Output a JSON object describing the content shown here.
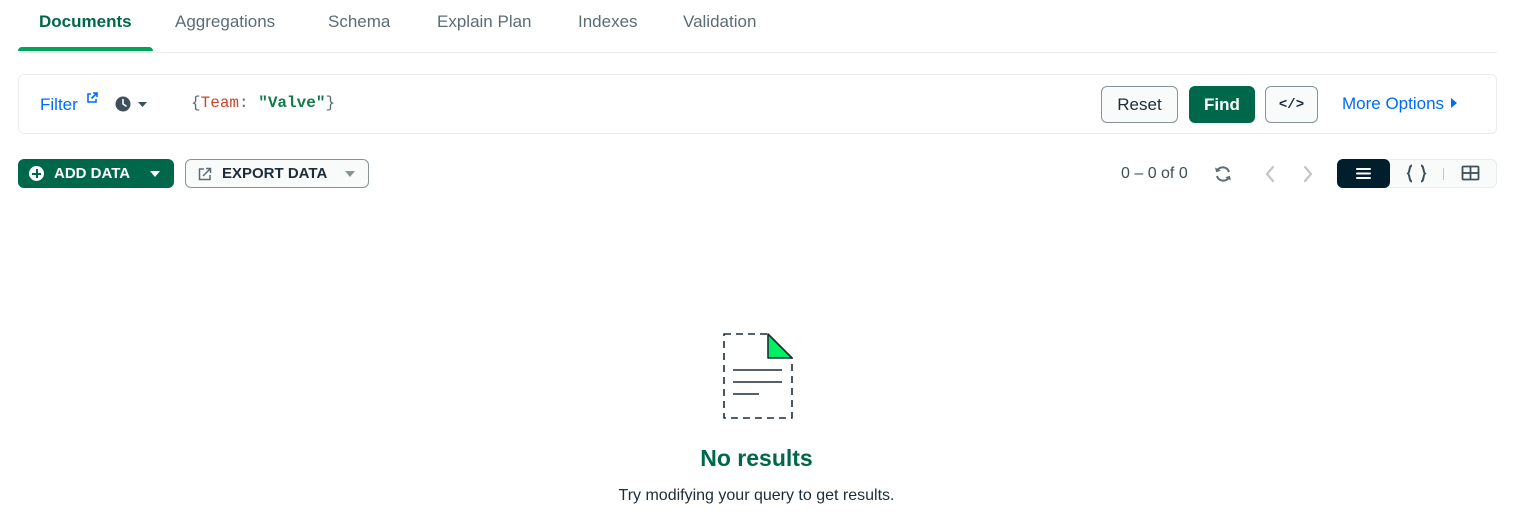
{
  "tabs": [
    {
      "label": "Documents",
      "active": true
    },
    {
      "label": "Aggregations"
    },
    {
      "label": "Schema"
    },
    {
      "label": "Explain Plan"
    },
    {
      "label": "Indexes"
    },
    {
      "label": "Validation"
    }
  ],
  "query_bar": {
    "filter_label": "Filter",
    "filter_link_icon": "external-link-icon",
    "history_icon": "clock-icon",
    "query": {
      "open": "{",
      "key": "Team",
      "sep": ": ",
      "value": "\"Valve\"",
      "close": "}"
    },
    "reset_label": "Reset",
    "find_label": "Find",
    "code_label": "</>",
    "more_options_label": "More Options"
  },
  "toolbar": {
    "add_data_label": "ADD DATA",
    "export_data_label": "EXPORT DATA",
    "pagination_text": "0 – 0 of 0"
  },
  "view_toggle": {
    "options": [
      "list",
      "json",
      "table"
    ],
    "selected": "list"
  },
  "empty_state": {
    "title": "No results",
    "subtitle": "Try modifying your query to get results."
  },
  "colors": {
    "brand_green": "#00684a",
    "tab_underline": "#00a35c",
    "link_blue": "#016bf8",
    "dark_navy": "#001e2b",
    "query_key": "#c7462e",
    "query_value": "#127a4b",
    "illustration_accent": "#00ed64"
  }
}
